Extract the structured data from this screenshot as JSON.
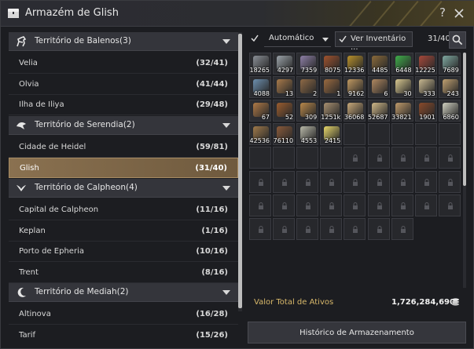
{
  "window": {
    "title": "Armazém de Glish",
    "help_label": "?"
  },
  "regions": [
    {
      "name": "Território de Balenos(3)",
      "icon": "horse-icon",
      "items": [
        {
          "name": "Velia",
          "count": "(32/41)"
        },
        {
          "name": "Olvia",
          "count": "(41/44)"
        },
        {
          "name": "Ilha de Iliya",
          "count": "(29/48)"
        }
      ]
    },
    {
      "name": "Território de Serendia(2)",
      "icon": "bird-icon",
      "items": [
        {
          "name": "Cidade de Heidel",
          "count": "(59/81)"
        },
        {
          "name": "Glish",
          "count": "(31/40)",
          "selected": true
        }
      ]
    },
    {
      "name": "Território de Calpheon(4)",
      "icon": "wings-icon",
      "items": [
        {
          "name": "Capital de Calpheon",
          "count": "(11/16)"
        },
        {
          "name": "Keplan",
          "count": "(1/16)"
        },
        {
          "name": "Porto de Epheria",
          "count": "(10/16)"
        },
        {
          "name": "Trent",
          "count": "(8/16)"
        }
      ]
    },
    {
      "name": "Território de Mediah(2)",
      "icon": "moon-icon",
      "items": [
        {
          "name": "Altinova",
          "count": "(16/28)"
        },
        {
          "name": "Tarif",
          "count": "(15/26)"
        }
      ]
    }
  ],
  "toolbar": {
    "auto_label": "Automático",
    "auto_checked": true,
    "inventory_label": "Ver Inventário ...",
    "inventory_checked": true,
    "capacity": "31/40"
  },
  "items": [
    {
      "qty": "18265",
      "icon": "ore-icon",
      "color": "#8a8f96"
    },
    {
      "qty": "4297",
      "icon": "ore-icon",
      "color": "#9aa2a8"
    },
    {
      "qty": "7359",
      "icon": "ore-icon",
      "color": "#8d7fa6"
    },
    {
      "qty": "8075",
      "icon": "rope-icon",
      "color": "#a0522d"
    },
    {
      "qty": "12336",
      "icon": "wood-icon",
      "color": "#b8902a"
    },
    {
      "qty": "4485",
      "icon": "twig-icon",
      "color": "#8a6a3a"
    },
    {
      "qty": "6448",
      "icon": "leaf-icon",
      "color": "#3fae4a"
    },
    {
      "qty": "12225",
      "icon": "meat-icon",
      "color": "#a6483a"
    },
    {
      "qty": "7689",
      "icon": "crystal-icon",
      "color": "#7fa8a0"
    },
    {
      "qty": "4088",
      "icon": "ore-icon",
      "color": "#6c8fae"
    },
    {
      "qty": "13",
      "icon": "plank-icon",
      "color": "#a87a4a"
    },
    {
      "qty": "2",
      "icon": "plank-icon",
      "color": "#8f6a46"
    },
    {
      "qty": "1",
      "icon": "plank-icon",
      "color": "#9a6a40"
    },
    {
      "qty": "9162",
      "icon": "plank-icon",
      "color": "#c09860"
    },
    {
      "qty": "6",
      "icon": "plank-icon",
      "color": "#b08860"
    },
    {
      "qty": "30",
      "icon": "plank-icon",
      "color": "#d8c890"
    },
    {
      "qty": "333",
      "icon": "plank-icon",
      "color": "#c8b890"
    },
    {
      "qty": "243",
      "icon": "plank-icon",
      "color": "#c0a070"
    },
    {
      "qty": "67",
      "icon": "plank-icon",
      "color": "#b07a46"
    },
    {
      "qty": "52",
      "icon": "plank-icon",
      "color": "#9a5c2e"
    },
    {
      "qty": "309",
      "icon": "plank-icon",
      "color": "#b8884a"
    },
    {
      "qty": "1251k",
      "icon": "plank-icon",
      "color": "#a89070"
    },
    {
      "qty": "36068",
      "icon": "plank-icon",
      "color": "#c8a878"
    },
    {
      "qty": "52687",
      "icon": "plank-icon",
      "color": "#d0b888"
    },
    {
      "qty": "33821",
      "icon": "plank-icon",
      "color": "#c09a6a"
    },
    {
      "qty": "1901",
      "icon": "plank-icon",
      "color": "#8a4a2a"
    },
    {
      "qty": "6860",
      "icon": "plank-icon",
      "color": "#d0d0c0"
    },
    {
      "qty": "42536",
      "icon": "branch-icon",
      "color": "#a07a4a"
    },
    {
      "qty": "76110",
      "icon": "branch-icon",
      "color": "#8a5a3a"
    },
    {
      "qty": "4553",
      "icon": "scroll-icon",
      "color": "#b8b8a8"
    },
    {
      "qty": "2415",
      "icon": "gem-icon",
      "color": "#e8d86a"
    }
  ],
  "empty_slots": 9,
  "locked_slots": 30,
  "footer": {
    "total_label": "Valor Total de Ativos",
    "total_value": "1,726,284,690",
    "history_label": "Histórico de Armazenamento"
  },
  "colors": {
    "accent": "#8a7150",
    "gold": "#d8b86a"
  }
}
